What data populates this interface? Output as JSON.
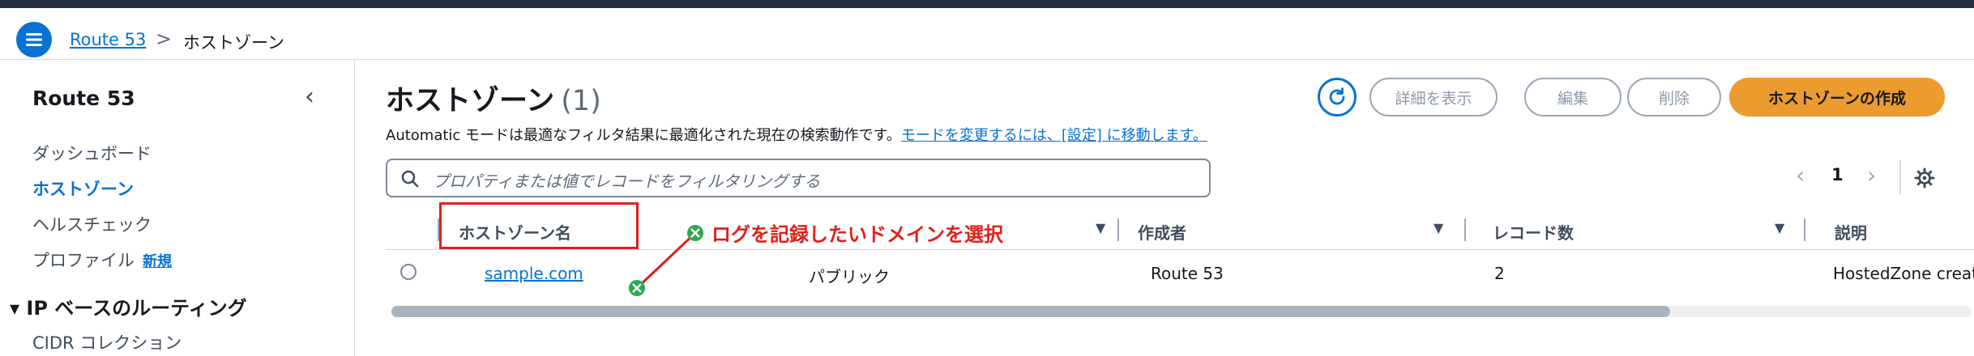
{
  "breadcrumb": {
    "service": "Route 53",
    "separator": ">",
    "current": "ホストゾーン"
  },
  "sidebar": {
    "title": "Route 53",
    "items": [
      {
        "label": "ダッシュボード",
        "active": false
      },
      {
        "label": "ホストゾーン",
        "active": true
      },
      {
        "label": "ヘルスチェック",
        "active": false
      },
      {
        "label": "プロファイル",
        "badge": "新規",
        "active": false
      }
    ],
    "section": {
      "label": "IP ベースのルーティング",
      "items": [
        {
          "label": "CIDR コレクション"
        }
      ]
    }
  },
  "header": {
    "title": "ホストゾーン",
    "count": "(1)",
    "info_text": "Automatic モードは最適なフィルタ結果に最適化された現在の検索動作です。",
    "info_link": "モードを変更するには、[設定] に移動します。"
  },
  "actions": {
    "details": "詳細を表示",
    "edit": "編集",
    "delete": "削除",
    "create": "ホストゾーンの作成"
  },
  "search": {
    "placeholder": "プロパティまたは値でレコードをフィルタリングする"
  },
  "pagination": {
    "current_page": "1"
  },
  "table": {
    "columns": [
      "ホストゾーン名",
      "作成者",
      "レコード数",
      "説明"
    ],
    "rows": [
      {
        "name": "sample.com",
        "type": "パブリック",
        "created_by": "Route 53",
        "record_count": "2",
        "description": "HostedZone creat"
      }
    ]
  },
  "annotation": {
    "text": "ログを記録したいドメインを選択"
  },
  "colors": {
    "accent": "#0972d3",
    "primary_button": "#ec9b2f",
    "annotation": "#e0201b",
    "topbar": "#232f3e"
  }
}
